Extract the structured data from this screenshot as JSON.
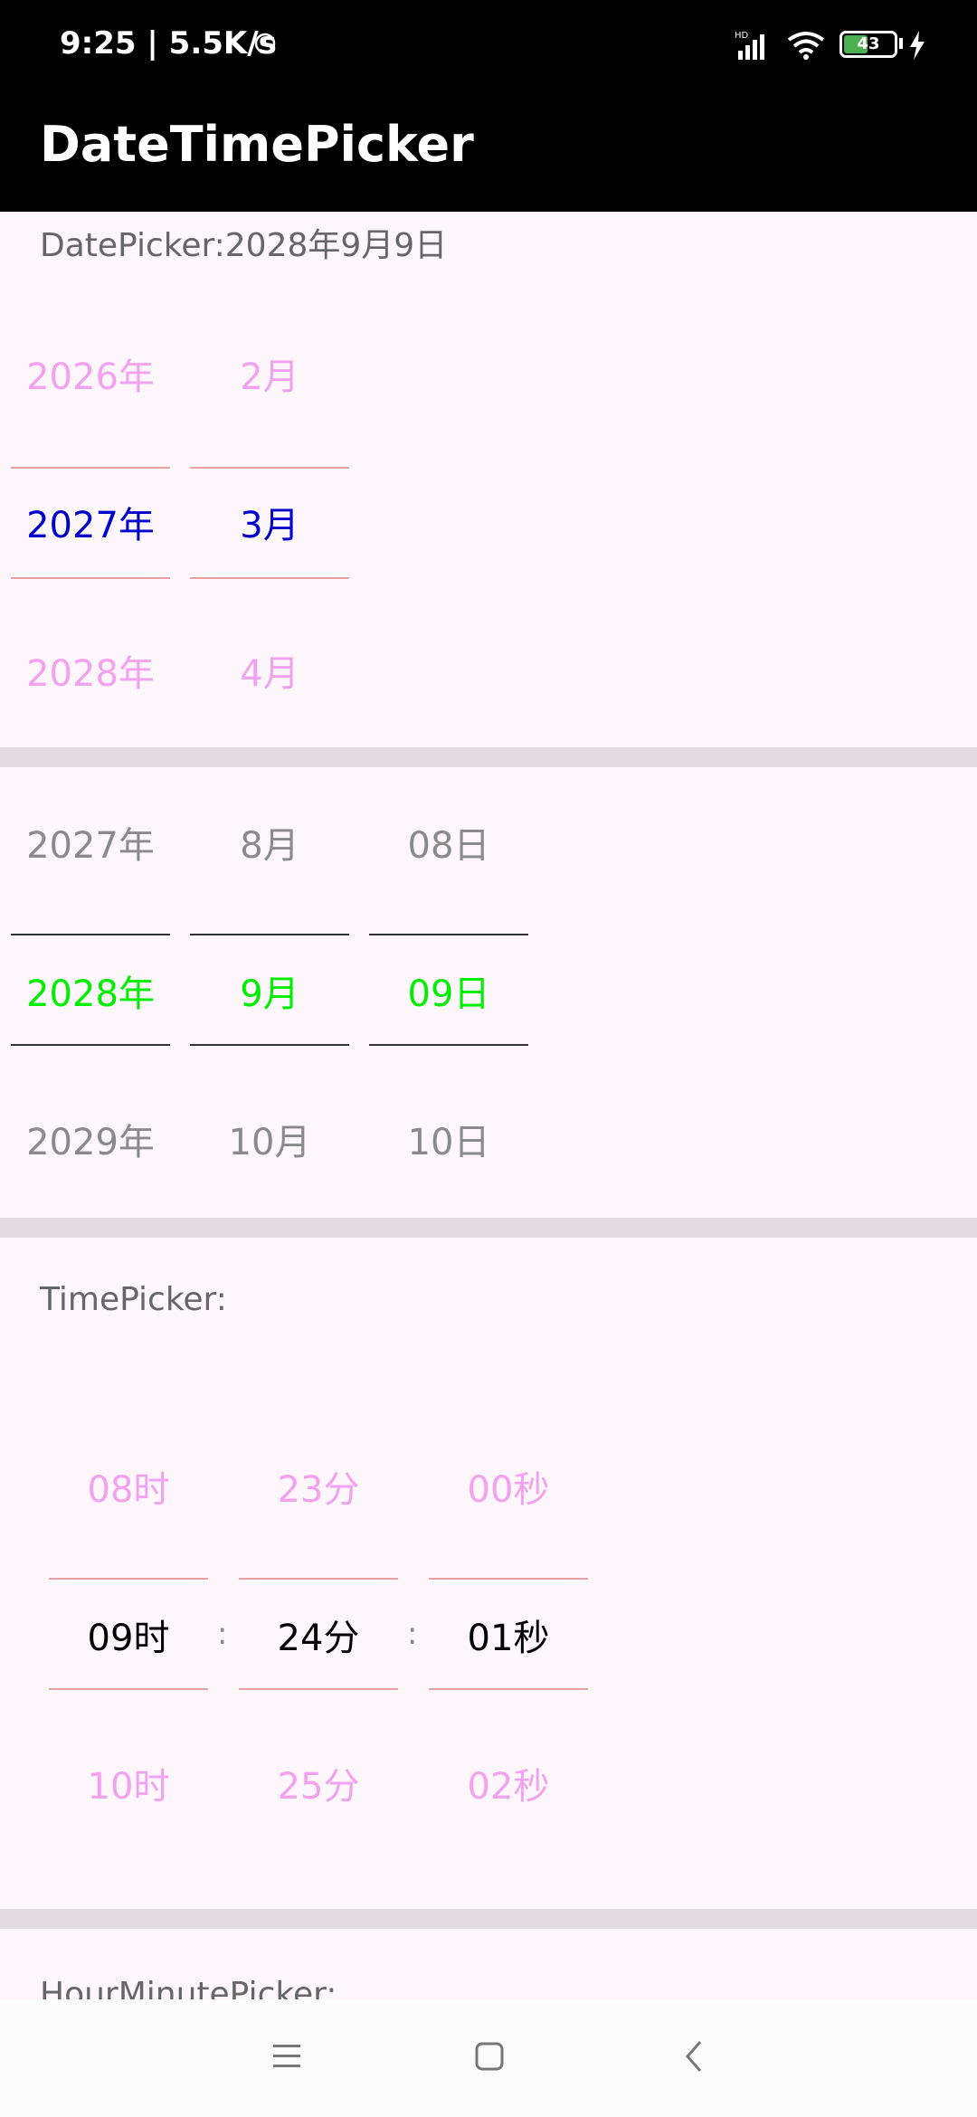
{
  "status": {
    "time": "9:25 | 5.5K/s",
    "battery": "43"
  },
  "app": {
    "title": "DateTimePicker"
  },
  "date_picker_1": {
    "label": "DatePicker:2028年9月9日",
    "year": {
      "prev": "2026年",
      "current": "2027年",
      "next": "2028年"
    },
    "month": {
      "prev": "2月",
      "current": "3月",
      "next": "4月"
    }
  },
  "date_picker_2": {
    "year": {
      "prev": "2027年",
      "current": "2028年",
      "next": "2029年"
    },
    "month": {
      "prev": "8月",
      "current": "9月",
      "next": "10月"
    },
    "day": {
      "prev": "08日",
      "current": "09日",
      "next": "10日"
    }
  },
  "time_picker": {
    "label": "TimePicker:",
    "hour": {
      "prev": "08时",
      "current": "09时",
      "next": "10时"
    },
    "minute": {
      "prev": "23分",
      "current": "24分",
      "next": "25分"
    },
    "second": {
      "prev": "00秒",
      "current": "01秒",
      "next": "02秒"
    },
    "separator": ":"
  },
  "hour_minute_picker": {
    "label": "HourMinutePicker:"
  },
  "colors": {
    "pink": "#f2a2ef",
    "blue": "#0000cc",
    "green": "#00ee00",
    "gray": "#8a8a8a",
    "red_line": "#e8a0a0"
  }
}
